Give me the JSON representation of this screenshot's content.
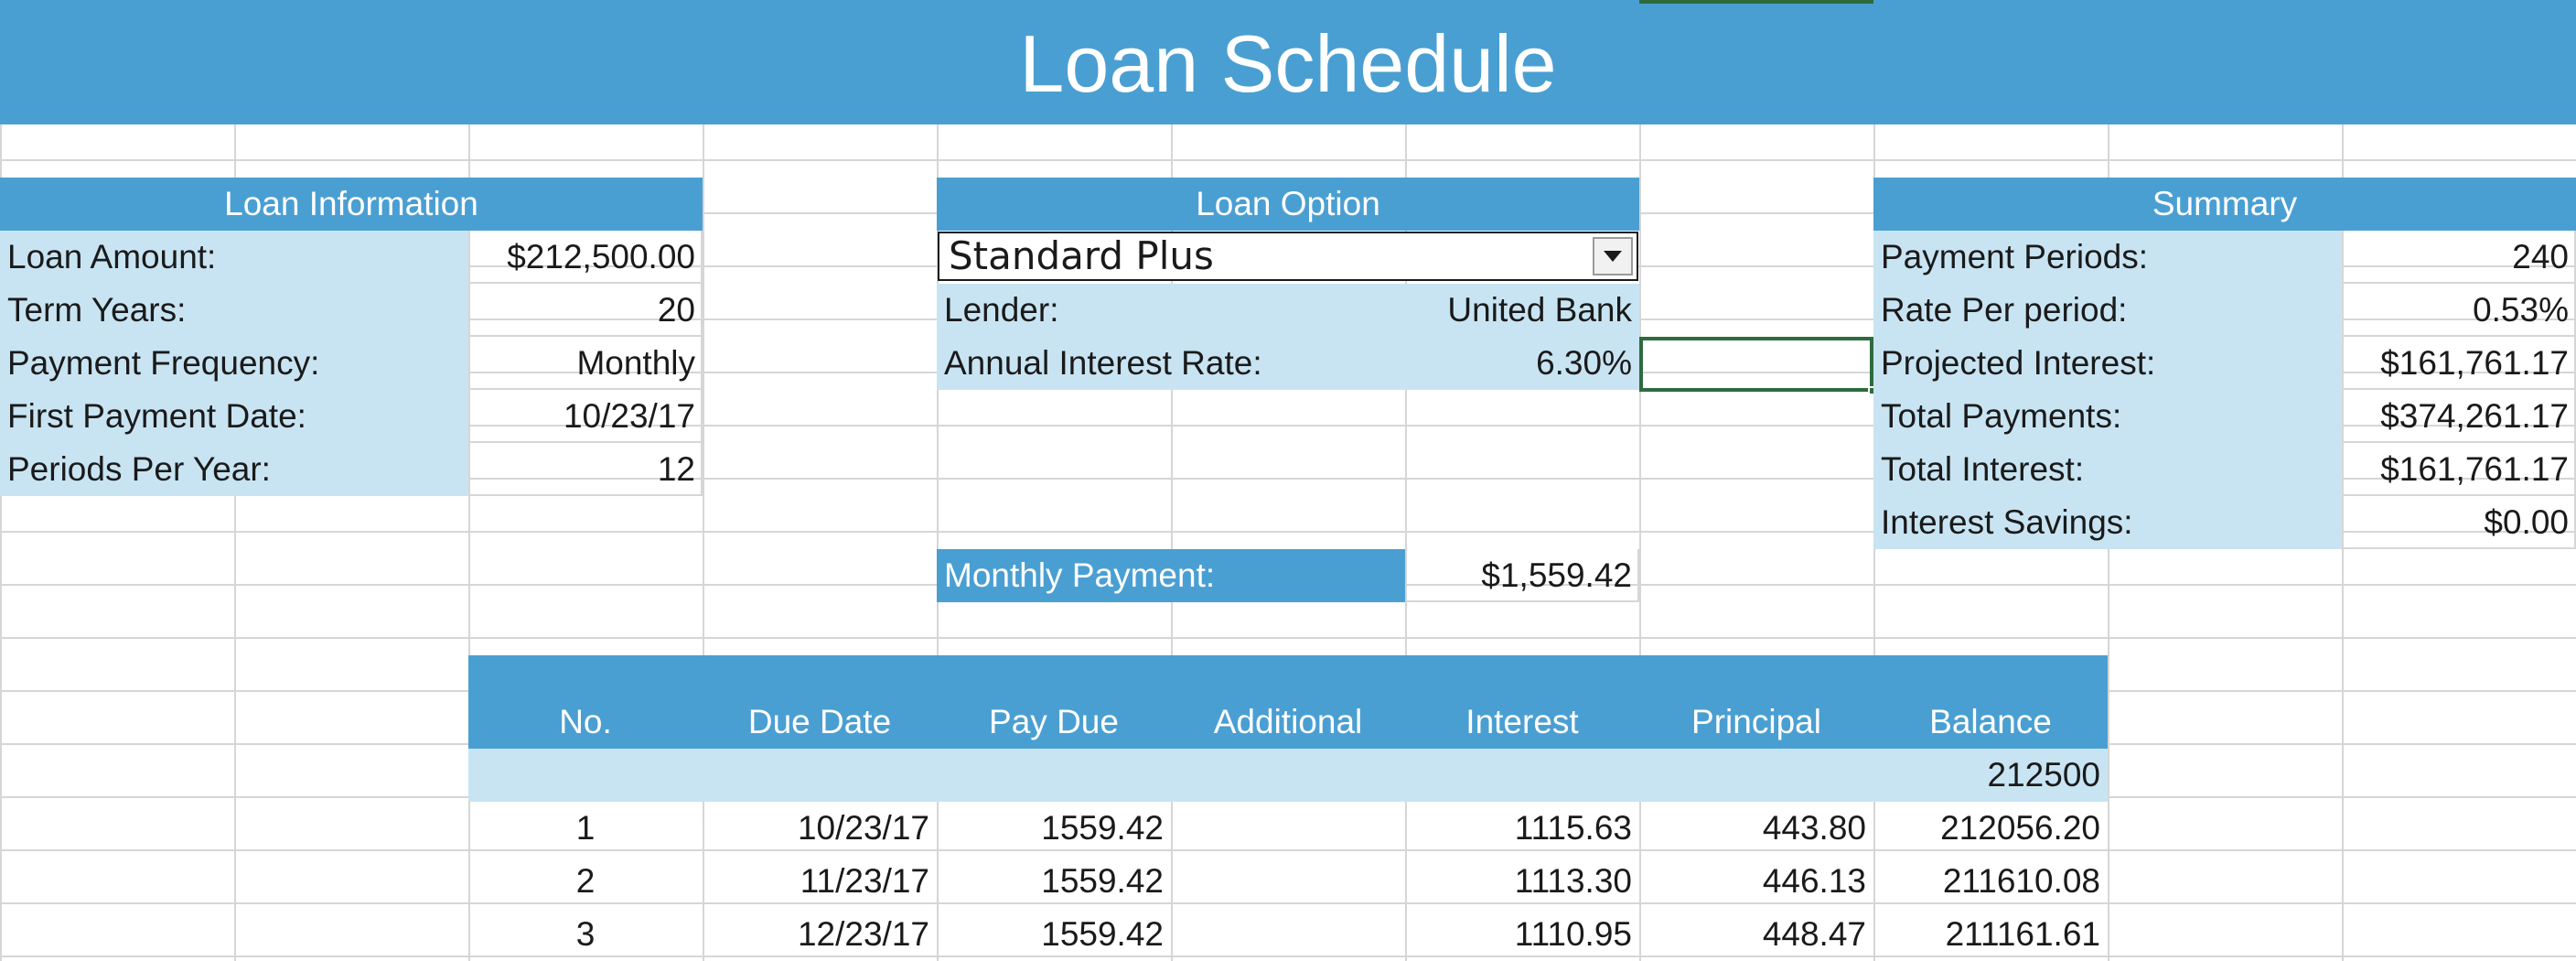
{
  "title": "Loan Schedule",
  "loan_information": {
    "header": "Loan Information",
    "rows": [
      {
        "label": "Loan Amount:",
        "value": "$212,500.00"
      },
      {
        "label": "Term Years:",
        "value": "20"
      },
      {
        "label": "Payment Frequency:",
        "value": "Monthly"
      },
      {
        "label": "First Payment Date:",
        "value": "10/23/17"
      },
      {
        "label": "Periods Per Year:",
        "value": "12"
      }
    ]
  },
  "loan_option": {
    "header": "Loan Option",
    "selected": "Standard Plus",
    "rows": [
      {
        "label": "Lender:",
        "value": "United Bank"
      },
      {
        "label": "Annual Interest Rate:",
        "value": "6.30%"
      }
    ],
    "payment_label": "Monthly Payment:",
    "payment_value": "$1,559.42"
  },
  "summary": {
    "header": "Summary",
    "rows": [
      {
        "label": "Payment Periods:",
        "value": "240"
      },
      {
        "label": "Rate Per period:",
        "value": "0.53%"
      },
      {
        "label": "Projected Interest:",
        "value": "$161,761.17"
      },
      {
        "label": "Total Payments:",
        "value": "$374,261.17"
      },
      {
        "label": "Total Interest:",
        "value": "$161,761.17"
      },
      {
        "label": "Interest Savings:",
        "value": "$0.00"
      }
    ]
  },
  "schedule": {
    "columns": [
      "No.",
      "Due Date",
      "Pay Due",
      "Additional",
      "Interest",
      "Principal",
      "Balance"
    ],
    "opening_balance": "212500",
    "rows": [
      [
        "1",
        "10/23/17",
        "1559.42",
        "",
        "1115.63",
        "443.80",
        "212056.20"
      ],
      [
        "2",
        "11/23/17",
        "1559.42",
        "",
        "1113.30",
        "446.13",
        "211610.08"
      ],
      [
        "3",
        "12/23/17",
        "1559.42",
        "",
        "1110.95",
        "448.47",
        "211161.61"
      ]
    ]
  },
  "colors": {
    "header_blue": "#4a9fd2",
    "light_blue": "#c8e4f2",
    "selection_green": "#2d6b3e",
    "gridline": "#d6d6d6"
  },
  "icons": {
    "dropdown": "chevron-down-icon"
  }
}
